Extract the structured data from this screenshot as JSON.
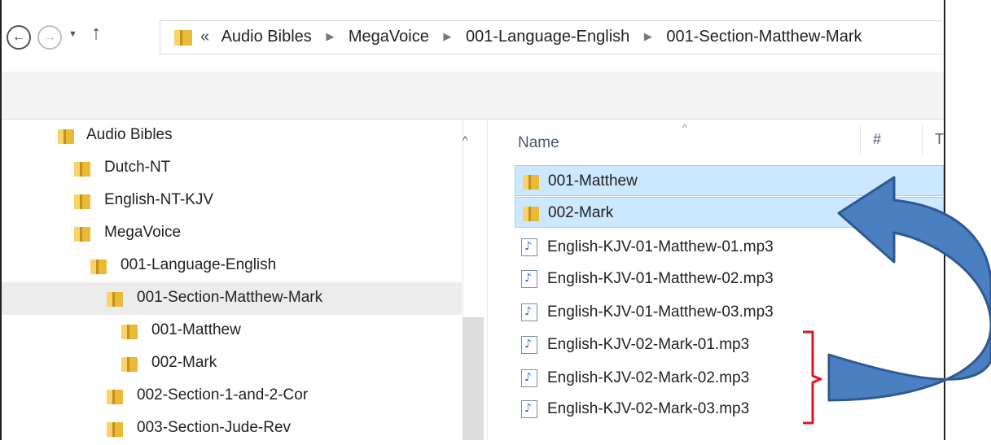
{
  "nav": {
    "back_icon": "back-arrow-icon",
    "forward_icon": "forward-arrow-icon",
    "recent_icon": "chevron-down-icon",
    "up_icon": "up-arrow-icon",
    "back_glyph": "←",
    "forward_glyph": "→",
    "recent_glyph": "▼",
    "up_glyph": "↑"
  },
  "address": {
    "lead": "«",
    "crumbs": [
      "Audio Bibles",
      "MegaVoice",
      "001-Language-English",
      "001-Section-Matthew-Mark"
    ],
    "sep": "▶"
  },
  "tree": {
    "items": [
      {
        "label": "Audio Bibles"
      },
      {
        "label": "Dutch-NT"
      },
      {
        "label": "English-NT-KJV"
      },
      {
        "label": "MegaVoice"
      },
      {
        "label": "001-Language-English"
      },
      {
        "label": "001-Section-Matthew-Mark",
        "selected": true
      },
      {
        "label": "001-Matthew"
      },
      {
        "label": "002-Mark"
      },
      {
        "label": "002-Section-1-and-2-Cor"
      },
      {
        "label": "003-Section-Jude-Rev"
      }
    ],
    "scroll_up_glyph": "^"
  },
  "columns": {
    "name": "Name",
    "sort_glyph": "^",
    "number": "#",
    "type_partial": "T"
  },
  "files": [
    {
      "label": "001-Matthew",
      "kind": "folder",
      "highlighted": true
    },
    {
      "label": "002-Mark",
      "kind": "folder",
      "highlighted": true
    },
    {
      "label": "English-KJV-01-Matthew-01.mp3",
      "kind": "audio"
    },
    {
      "label": "English-KJV-01-Matthew-02.mp3",
      "kind": "audio"
    },
    {
      "label": "English-KJV-01-Matthew-03.mp3",
      "kind": "audio"
    },
    {
      "label": "English-KJV-02-Mark-01.mp3",
      "kind": "audio"
    },
    {
      "label": "English-KJV-02-Mark-02.mp3",
      "kind": "audio"
    },
    {
      "label": "English-KJV-02-Mark-03.mp3",
      "kind": "audio"
    }
  ],
  "audio_glyph": "♪",
  "colors": {
    "highlight": "#cce8ff",
    "annotation_arrow": "#4a7fc1",
    "annotation_bracket": "#e0141e",
    "folder": "#f5c342"
  }
}
